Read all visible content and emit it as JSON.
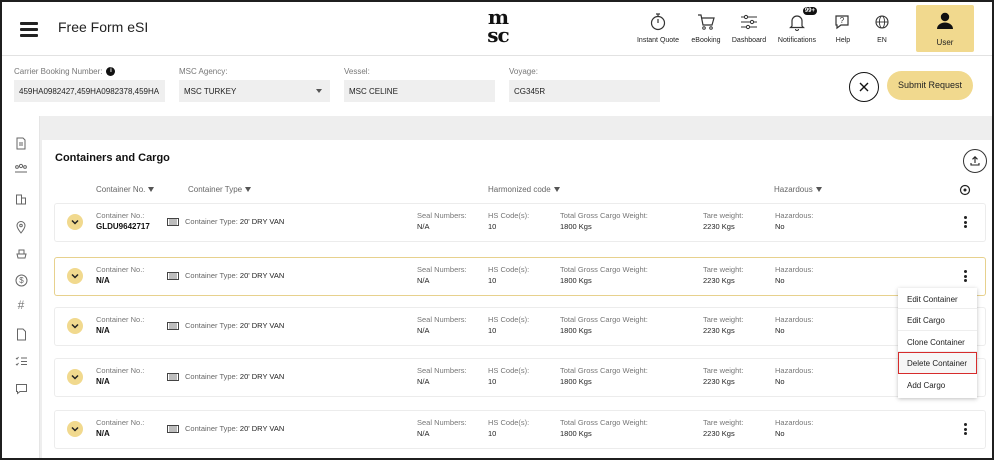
{
  "header": {
    "app_title": "Free Form eSI",
    "logo_text_1": "m",
    "logo_text_2": "sc",
    "nav": [
      {
        "label": "Instant Quote",
        "icon": "timer-icon"
      },
      {
        "label": "eBooking",
        "icon": "cart-icon"
      },
      {
        "label": "Dashboard",
        "icon": "sliders-icon"
      },
      {
        "label": "Notifications",
        "icon": "bell-icon",
        "badge": "99+"
      },
      {
        "label": "Help",
        "icon": "help-chat-icon"
      },
      {
        "label": "EN",
        "icon": "globe-icon"
      }
    ],
    "user_label": "User"
  },
  "form": {
    "booking_label": "Carrier Booking Number:",
    "booking_value": "459HA0982427,459HA0982378,459HA",
    "agency_label": "MSC Agency:",
    "agency_value": "MSC TURKEY",
    "vessel_label": "Vessel:",
    "vessel_value": "MSC CELINE",
    "voyage_label": "Voyage:",
    "voyage_value": "CG345R",
    "submit_label": "Submit Request"
  },
  "section": {
    "title": "Containers and Cargo",
    "columns": [
      "Container No.",
      "Container Type",
      "Harmonized code",
      "Hazardous"
    ]
  },
  "labels": {
    "container_no": "Container No.:",
    "container_type": "Container Type:",
    "seal": "Seal Numbers:",
    "hs": "HS Code(s):",
    "gross": "Total Gross Cargo Weight:",
    "tare": "Tare weight:",
    "hazardous": "Hazardous:"
  },
  "rows": [
    {
      "container_no": "GLDU9642717",
      "type": "20' DRY VAN",
      "seal": "N/A",
      "hs": "10",
      "gross": "1800 Kgs",
      "tare": "2230 Kgs",
      "hazardous": "No"
    },
    {
      "container_no": "N/A",
      "type": "20' DRY VAN",
      "seal": "N/A",
      "hs": "10",
      "gross": "1800 Kgs",
      "tare": "2230 Kgs",
      "hazardous": "No"
    },
    {
      "container_no": "N/A",
      "type": "20' DRY VAN",
      "seal": "N/A",
      "hs": "10",
      "gross": "1800 Kgs",
      "tare": "2230 Kgs",
      "hazardous": "No"
    },
    {
      "container_no": "N/A",
      "type": "20' DRY VAN",
      "seal": "N/A",
      "hs": "10",
      "gross": "1800 Kgs",
      "tare": "2230 Kgs",
      "hazardous": "No"
    },
    {
      "container_no": "N/A",
      "type": "20' DRY VAN",
      "seal": "N/A",
      "hs": "10",
      "gross": "1800 Kgs",
      "tare": "2230 Kgs",
      "hazardous": "No"
    }
  ],
  "context_menu": [
    "Edit Container",
    "Edit Cargo",
    "Clone Container",
    "Delete Container",
    "Add Cargo"
  ],
  "colors": {
    "accent": "#f1d98e",
    "highlight_border": "#d62b2b"
  }
}
